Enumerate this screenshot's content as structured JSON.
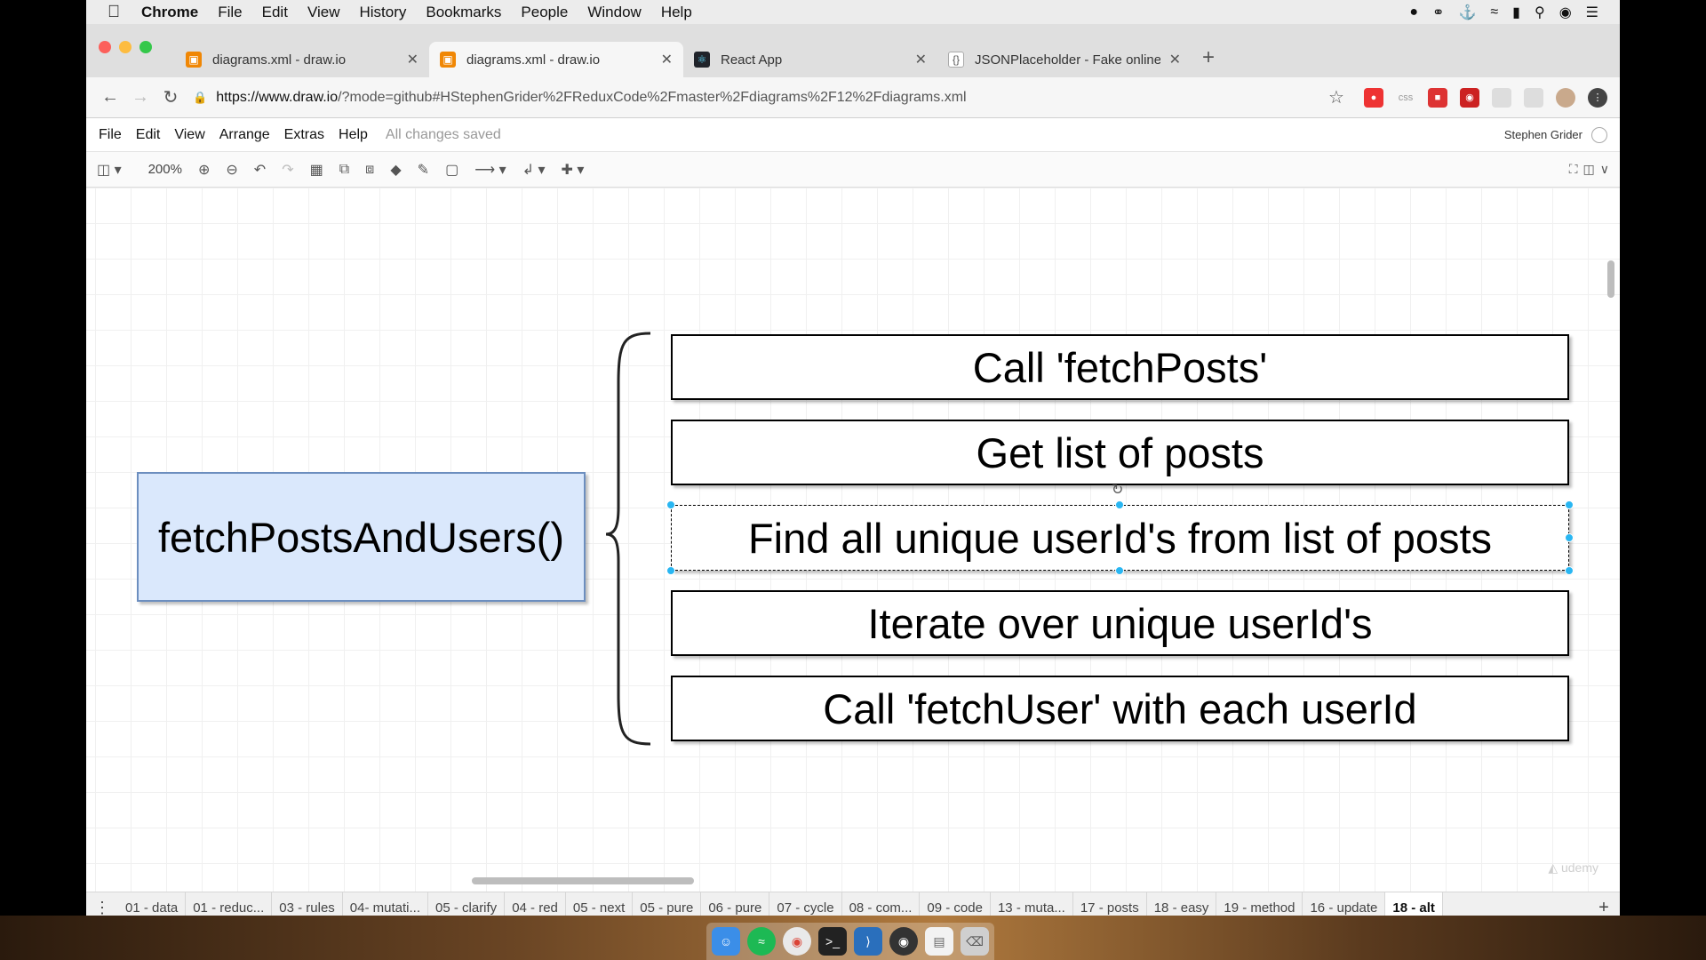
{
  "menubar": {
    "app": "Chrome",
    "items": [
      "File",
      "Edit",
      "View",
      "History",
      "Bookmarks",
      "People",
      "Window",
      "Help"
    ]
  },
  "tabs": [
    {
      "title": "diagrams.xml - draw.io",
      "icon": "drawio-icon",
      "color": "#f08705",
      "active": false
    },
    {
      "title": "diagrams.xml - draw.io",
      "icon": "drawio-icon",
      "color": "#f08705",
      "active": true
    },
    {
      "title": "React App",
      "icon": "react-icon",
      "color": "#20232a",
      "active": false
    },
    {
      "title": "JSONPlaceholder - Fake online",
      "icon": "jsonplaceholder-icon",
      "color": "#777777",
      "active": false
    }
  ],
  "address": {
    "host": "https://www.draw.io",
    "rest": "/?mode=github#HStephenGrider%2FReduxCode%2Fmaster%2Fdiagrams%2F12%2Fdiagrams.xml"
  },
  "extensions": {
    "css": "css"
  },
  "app": {
    "menu": [
      "File",
      "Edit",
      "View",
      "Arrange",
      "Extras",
      "Help"
    ],
    "status": "All changes saved",
    "user": "Stephen Grider",
    "zoom": "200%"
  },
  "diagram": {
    "main": "fetchPostsAndUsers()",
    "steps": [
      "Call 'fetchPosts'",
      "Get list of posts",
      "Find all unique userId's from list of posts",
      "Iterate over unique userId's",
      "Call 'fetchUser' with each userId"
    ],
    "colors": {
      "main_fill": "#dae8fc",
      "main_stroke": "#6c8ebf",
      "selection": "#29b6f2"
    }
  },
  "pages": [
    "01 - data",
    "01 - reduc...",
    "03 - rules",
    "04- mutati...",
    "05 - clarify",
    "04 - red",
    "05 - next",
    "05 - pure",
    "06 - pure",
    "07 - cycle",
    "08 - com...",
    "09 - code",
    "13 - muta...",
    "17 - posts",
    "18 - easy",
    "19 - method",
    "16 - update",
    "18 - alt"
  ],
  "active_page": "18 - alt"
}
